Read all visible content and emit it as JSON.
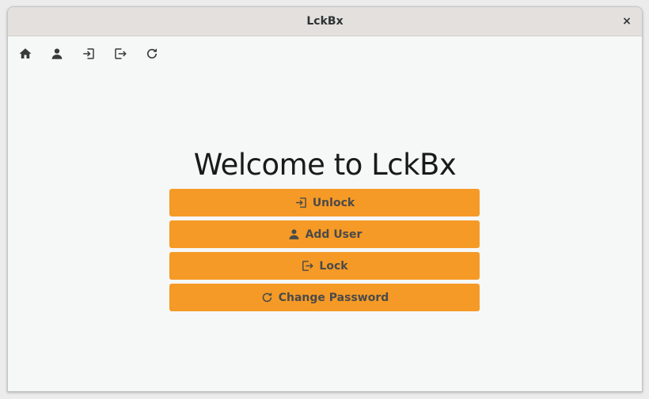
{
  "window": {
    "title": "LckBx",
    "close_label": "×"
  },
  "toolbar": {
    "items": [
      {
        "icon": "home-icon"
      },
      {
        "icon": "user-icon"
      },
      {
        "icon": "login-icon"
      },
      {
        "icon": "logout-icon"
      },
      {
        "icon": "refresh-icon"
      }
    ]
  },
  "main": {
    "heading": "Welcome to LckBx",
    "buttons": [
      {
        "label": "Unlock",
        "icon": "login-icon"
      },
      {
        "label": "Add User",
        "icon": "user-icon"
      },
      {
        "label": "Lock",
        "icon": "logout-icon"
      },
      {
        "label": "Change Password",
        "icon": "refresh-icon"
      }
    ]
  },
  "colors": {
    "accent": "#f59a26",
    "window_bg": "#f6f7f7",
    "titlebar_bg": "#e3e0dd",
    "button_text": "#4a4a4a"
  }
}
